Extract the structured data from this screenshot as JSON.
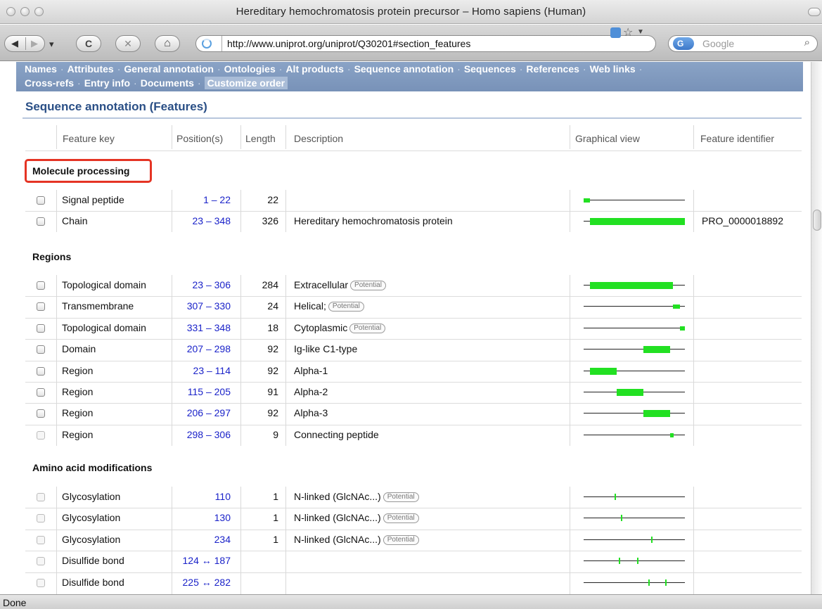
{
  "window": {
    "title": "Hereditary hemochromatosis protein precursor – Homo sapiens (Human)"
  },
  "toolbar": {
    "url": "http://www.uniprot.org/uniprot/Q30201#section_features",
    "search_placeholder": "Google",
    "back_glyph": "◀",
    "forward_glyph": "▶",
    "history_glyph": "▾",
    "reload_glyph": "C",
    "stop_glyph": "✕",
    "home_glyph": "⌂",
    "star_glyph": "☆",
    "drop_glyph": "▼",
    "search_glyph": "⌕",
    "google_glyph": "G"
  },
  "nav": {
    "line1": [
      "Names",
      "Attributes",
      "General annotation",
      "Ontologies",
      "Alt products",
      "Sequence annotation",
      "Sequences",
      "References",
      "Web links"
    ],
    "line2": [
      "Cross-refs",
      "Entry info",
      "Documents"
    ],
    "customize": "Customize order",
    "separator": "·"
  },
  "section": {
    "title": "Sequence annotation (Features)"
  },
  "columns": {
    "feature_key": "Feature key",
    "positions": "Position(s)",
    "length": "Length",
    "description": "Description",
    "graphical_view": "Graphical view",
    "feature_identifier": "Feature identifier"
  },
  "groups": [
    {
      "title": "Molecule processing",
      "rows": [
        {
          "key": "Signal peptide",
          "pos": "1 – 22",
          "len": "22",
          "desc": "",
          "tag": "",
          "id": "",
          "start": 1,
          "end": 22
        },
        {
          "key": "Chain",
          "pos": "23 – 348",
          "len": "326",
          "desc": "Hereditary hemochromatosis protein",
          "tag": "",
          "id": "PRO_0000018892",
          "start": 23,
          "end": 348
        }
      ]
    },
    {
      "title": "Regions",
      "rows": [
        {
          "key": "Topological domain",
          "pos": "23 – 306",
          "len": "284",
          "desc": "Extracellular",
          "tag": "Potential",
          "id": "",
          "start": 23,
          "end": 306
        },
        {
          "key": "Transmembrane",
          "pos": "307 – 330",
          "len": "24",
          "desc": "Helical;",
          "tag": "Potential",
          "id": "",
          "start": 307,
          "end": 330
        },
        {
          "key": "Topological domain",
          "pos": "331 – 348",
          "len": "18",
          "desc": "Cytoplasmic",
          "tag": "Potential",
          "id": "",
          "start": 331,
          "end": 348
        },
        {
          "key": "Domain",
          "pos": "207 – 298",
          "len": "92",
          "desc": "Ig-like C1-type",
          "tag": "",
          "id": "",
          "start": 207,
          "end": 298
        },
        {
          "key": "Region",
          "pos": "23 – 114",
          "len": "92",
          "desc": "Alpha-1",
          "tag": "",
          "id": "",
          "start": 23,
          "end": 114
        },
        {
          "key": "Region",
          "pos": "115 – 205",
          "len": "91",
          "desc": "Alpha-2",
          "tag": "",
          "id": "",
          "start": 115,
          "end": 205
        },
        {
          "key": "Region",
          "pos": "206 – 297",
          "len": "92",
          "desc": "Alpha-3",
          "tag": "",
          "id": "",
          "start": 206,
          "end": 297
        },
        {
          "key": "Region",
          "pos": "298 – 306",
          "len": "9",
          "desc": "Connecting peptide",
          "tag": "",
          "id": "",
          "start": 298,
          "end": 306
        }
      ]
    },
    {
      "title": "Amino acid modifications",
      "rows": [
        {
          "key": "Glycosylation",
          "pos": "110",
          "len": "1",
          "desc": "N-linked (GlcNAc...)",
          "tag": "Potential",
          "id": "",
          "ticks": [
            110
          ]
        },
        {
          "key": "Glycosylation",
          "pos": "130",
          "len": "1",
          "desc": "N-linked (GlcNAc...)",
          "tag": "Potential",
          "id": "",
          "ticks": [
            130
          ]
        },
        {
          "key": "Glycosylation",
          "pos": "234",
          "len": "1",
          "desc": "N-linked (GlcNAc...)",
          "tag": "Potential",
          "id": "",
          "ticks": [
            234
          ]
        },
        {
          "key": "Disulfide bond",
          "pos": "124 ↔ 187",
          "len": "",
          "desc": "",
          "tag": "",
          "id": "",
          "ticks": [
            124,
            187
          ]
        },
        {
          "key": "Disulfide bond",
          "pos": "225 ↔ 282",
          "len": "",
          "desc": "",
          "tag": "",
          "id": "",
          "ticks": [
            225,
            282
          ]
        }
      ]
    }
  ],
  "sequence_length": 348,
  "status": {
    "text": "Done"
  },
  "colors": {
    "feature_bar": "#22e022",
    "position_link": "#1a22c9",
    "nav_strip": "#8aa3c6",
    "section_title": "#2a4f86",
    "highlight_box": "#e53424"
  }
}
